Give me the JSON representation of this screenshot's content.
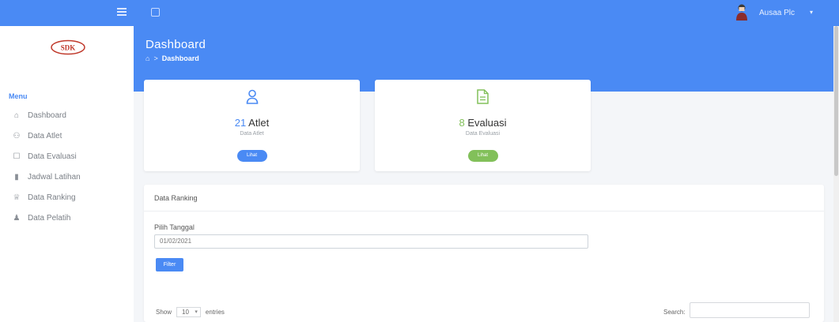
{
  "topbar": {
    "user_name": "Ausaa Plc"
  },
  "sidebar": {
    "menu_label": "Menu",
    "items": [
      {
        "label": "Dashboard",
        "icon": "home-icon"
      },
      {
        "label": "Data Atlet",
        "icon": "user-icon"
      },
      {
        "label": "Data Evaluasi",
        "icon": "file-icon"
      },
      {
        "label": "Jadwal Latihan",
        "icon": "chart-icon"
      },
      {
        "label": "Data Ranking",
        "icon": "trophy-icon"
      },
      {
        "label": "Data Pelatih",
        "icon": "users-icon"
      }
    ]
  },
  "header": {
    "title": "Dashboard",
    "breadcrumb": {
      "separator": ">",
      "current": "Dashboard"
    }
  },
  "cards": {
    "atlet": {
      "number": "21",
      "label": "Atlet",
      "sub": "Data Atlet",
      "button": "Lihat"
    },
    "evaluasi": {
      "number": "8",
      "label": "Evaluasi",
      "sub": "Data Evaluasi",
      "button": "Lihat"
    }
  },
  "ranking_panel": {
    "title": "Data Ranking",
    "field_label": "Pilih Tanggal",
    "date_value": "01/02/2021",
    "filter_button": "Filter",
    "show_label": "Show",
    "entries_value": "10",
    "entries_label": "entries",
    "search_label": "Search:"
  },
  "colors": {
    "primary": "#4a8af4",
    "success": "#82c05a",
    "sidebar_text": "#7a7f86"
  }
}
